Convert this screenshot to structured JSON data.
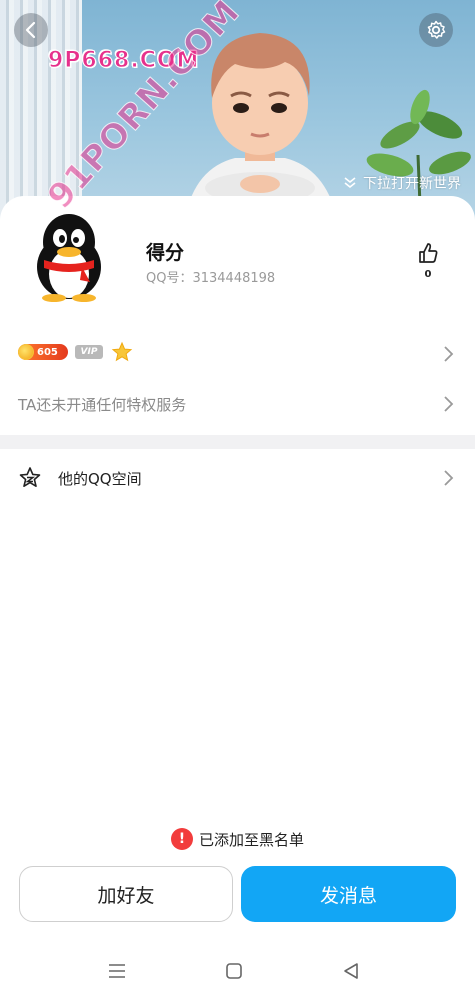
{
  "cover": {
    "watermark_top": "9P668.COM",
    "pull_hint": "下拉打开新世界"
  },
  "profile": {
    "nickname": "得分",
    "qq_number": "QQ号：3134448198",
    "like_count": "0"
  },
  "badges": {
    "coin_level": "605",
    "vip_label": "VIP"
  },
  "privilege": {
    "text": "TA还未开通任何特权服务"
  },
  "qzone": {
    "label": "他的QQ空间"
  },
  "watermark_overlay": "91PORN.COM",
  "blacklist_note": {
    "icon": "!",
    "text": "已添加至黑名单"
  },
  "actions": {
    "add_friend": "加好友",
    "send_message": "发消息"
  },
  "colors": {
    "primary_button": "#12a6f5",
    "warning": "#f23c3c",
    "watermark": "#e6318c"
  },
  "icons": [
    "back-icon",
    "settings-icon",
    "chevron-down-double-icon",
    "thumbs-up-icon",
    "star-icon",
    "chevron-right-icon",
    "qzone-star-icon",
    "warning-icon",
    "menu-icon",
    "home-square-icon",
    "back-triangle-icon"
  ]
}
